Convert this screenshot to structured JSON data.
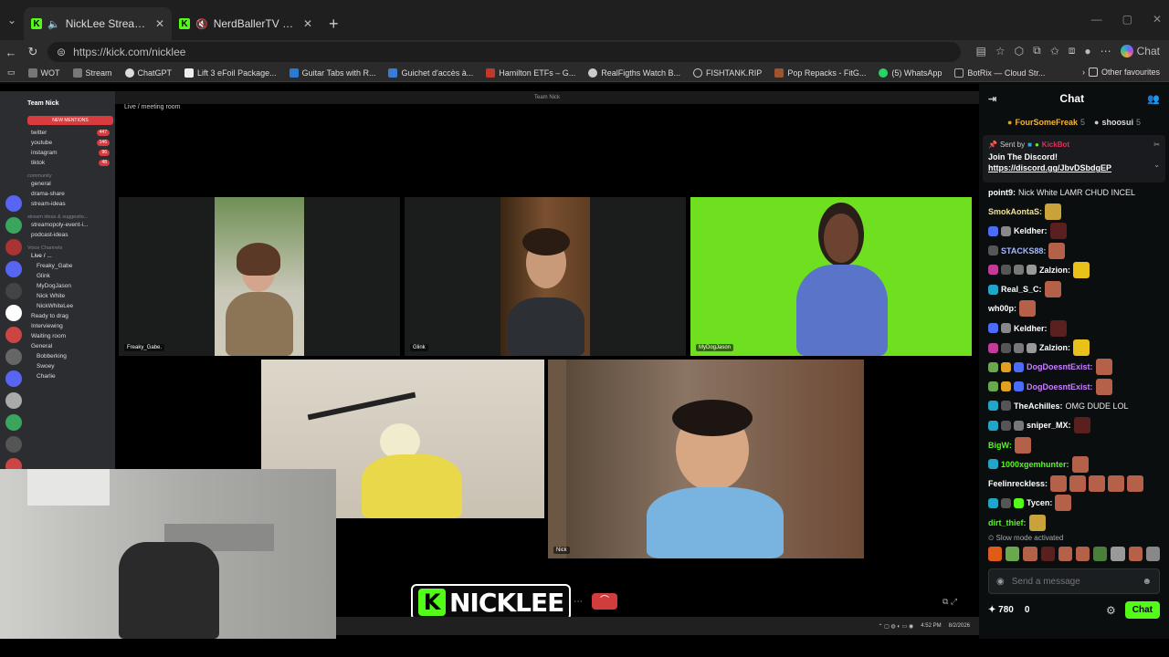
{
  "browser": {
    "tabs": [
      {
        "title": "NickLee Stream - Watch Live a",
        "active": true
      },
      {
        "title": "NerdBallerTV Stream - Watch",
        "active": false
      }
    ],
    "url": "https://kick.com/nicklee",
    "copilot_label": "Chat",
    "bookmarks": [
      "WOT",
      "Stream",
      "ChatGPT",
      "Lift 3 eFoil Package...",
      "Guitar Tabs with R...",
      "Guichet d'accès à...",
      "Hamilton ETFs – G...",
      "RealFigths Watch B...",
      "FISHTANK.RIP",
      "Pop Repacks - FitG...",
      "(5) WhatsApp",
      "BotRix — Cloud Str..."
    ],
    "other_favourites": "Other favourites"
  },
  "stream": {
    "discord": {
      "server": "Team Nick",
      "new_mentions": "NEW MENTIONS",
      "channels": [
        {
          "name": "twitter",
          "count": "447"
        },
        {
          "name": "youtube",
          "count": "146"
        },
        {
          "name": "instagram",
          "count": "96"
        },
        {
          "name": "tiktok",
          "count": "48"
        }
      ],
      "community_label": "community",
      "community": [
        "general",
        "drama-share",
        "stream-ideas"
      ],
      "ideas_label": "stream ideas & suggestio...",
      "ideas": [
        "streamopoly-event-i...",
        "podcast-ideas"
      ],
      "voice_label": "Voice Channels",
      "voice": [
        "Live / ...",
        "Freaky_Gabe",
        "Glink",
        "MyDogJason",
        "Nick White",
        "NickWhiteLee",
        "Ready to drag",
        "Interviewing",
        "Waiting room",
        "General",
        "Bobberking",
        "Swoey",
        "Charlie"
      ]
    },
    "meeting_window_title": "Team Nick",
    "meeting_header": "Live / meeting room",
    "tiles": [
      {
        "name": "Freaky_Gabe."
      },
      {
        "name": "Glink"
      },
      {
        "name": "MyDogJason"
      },
      {
        "name": ""
      },
      {
        "name": "Nick"
      }
    ],
    "logo_text": "NICKLEE",
    "logo_letter": "K",
    "taskbar_time": "4:52 PM",
    "taskbar_date": "8/2/2026"
  },
  "chat": {
    "title": "Chat",
    "gifters": [
      {
        "name": "FourSomeFreak",
        "count": "5"
      },
      {
        "name": "shoosui",
        "count": "5"
      }
    ],
    "pinned": {
      "sent_by": "Sent by",
      "bot": "KickBot",
      "message": "Join The Discord!",
      "link": "https://discord.gg/JbvDSbdgEP"
    },
    "messages": [
      {
        "user": "point9:",
        "color": "#ffffff",
        "text": "Nick White LAMR CHUD INCEL",
        "badges": [],
        "emotes": []
      },
      {
        "user": "SmokAontaS:",
        "color": "#f2e29b",
        "text": "",
        "badges": [],
        "emotes": [
          "#c9a33a"
        ]
      },
      {
        "user": "Keldher:",
        "color": "#ffffff",
        "text": "",
        "badges": [
          "#4a6cf7",
          "#888"
        ],
        "emotes": [
          "#5a1f1f"
        ]
      },
      {
        "user": "STACKS88:",
        "color": "#a8b8ff",
        "text": "",
        "badges": [
          "#555"
        ],
        "emotes": [
          "#b5614a"
        ]
      },
      {
        "user": "Zalzion:",
        "color": "#ffffff",
        "text": "",
        "badges": [
          "#c23b9a",
          "#555",
          "#777",
          "#999"
        ],
        "emotes": [
          "#e8c21a"
        ]
      },
      {
        "user": "Real_S_C:",
        "color": "#ffffff",
        "text": "",
        "badges": [
          "#1fa6c9"
        ],
        "emotes": [
          "#b5614a"
        ]
      },
      {
        "user": "wh00p:",
        "color": "#ffffff",
        "text": "",
        "badges": [],
        "emotes": [
          "#b5614a"
        ]
      },
      {
        "user": "Keldher:",
        "color": "#ffffff",
        "text": "",
        "badges": [
          "#4a6cf7",
          "#888"
        ],
        "emotes": [
          "#5a1f1f"
        ]
      },
      {
        "user": "Zalzion:",
        "color": "#ffffff",
        "text": "",
        "badges": [
          "#c23b9a",
          "#555",
          "#777",
          "#999"
        ],
        "emotes": [
          "#e8c21a"
        ]
      },
      {
        "user": "DogDoesntExist:",
        "color": "#c77dff",
        "text": "",
        "badges": [
          "#6aa84f",
          "#e0a020",
          "#4a6cf7"
        ],
        "emotes": [
          "#b5614a"
        ]
      },
      {
        "user": "DogDoesntExist:",
        "color": "#c77dff",
        "text": "",
        "badges": [
          "#6aa84f",
          "#e0a020",
          "#4a6cf7"
        ],
        "emotes": [
          "#b5614a"
        ]
      },
      {
        "user": "TheAchilles:",
        "color": "#ffffff",
        "text": "OMG DUDE LOL",
        "badges": [
          "#1fa6c9",
          "#555"
        ],
        "emotes": []
      },
      {
        "user": "sniper_MX:",
        "color": "#ffffff",
        "text": "",
        "badges": [
          "#1fa6c9",
          "#555",
          "#777"
        ],
        "emotes": [
          "#5a1f1f"
        ]
      },
      {
        "user": "BigW:",
        "color": "#53fc18",
        "text": "",
        "badges": [],
        "emotes": [
          "#b5614a"
        ]
      },
      {
        "user": "1000xgemhunter:",
        "color": "#53fc18",
        "text": "",
        "badges": [
          "#1fa6c9"
        ],
        "emotes": [
          "#b5614a"
        ]
      },
      {
        "user": "Feelinreckless:",
        "color": "#ffffff",
        "text": "",
        "badges": [],
        "emotes": [
          "#b5614a",
          "#b5614a",
          "#b5614a",
          "#b5614a",
          "#b5614a"
        ]
      },
      {
        "user": "Tycen:",
        "color": "#ffffff",
        "text": "",
        "badges": [
          "#1fa6c9",
          "#555",
          "#53fc18"
        ],
        "emotes": [
          "#b5614a"
        ]
      },
      {
        "user": "dirt_thief:",
        "color": "#53fc18",
        "text": "",
        "badges": [],
        "emotes": [
          "#c9a33a"
        ]
      }
    ],
    "slow_mode": "Slow mode activated",
    "emote_bar": [
      "#e05a1a",
      "#6aa84f",
      "#b5614a",
      "#5a1f1f",
      "#b5614a",
      "#b5614a",
      "#4a7f3a",
      "#999",
      "#b5614a",
      "#888"
    ],
    "input_placeholder": "Send a message",
    "points": "780",
    "count2": "0",
    "send_label": "Chat"
  }
}
